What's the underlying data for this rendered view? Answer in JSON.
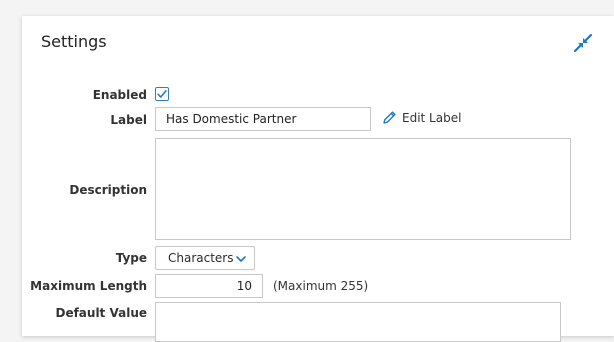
{
  "panel": {
    "title": "Settings",
    "collapse_icon": "collapse-arrows-icon",
    "accent_color": "#1f78c8"
  },
  "fields": {
    "enabled": {
      "label": "Enabled",
      "checked": true
    },
    "label": {
      "label": "Label",
      "value": "Has Domestic Partner",
      "edit_link": "Edit Label"
    },
    "description": {
      "label": "Description",
      "value": ""
    },
    "type": {
      "label": "Type",
      "value": "Characters"
    },
    "max_length": {
      "label": "Maximum Length",
      "value": "10",
      "hint": "(Maximum 255)"
    },
    "default_value": {
      "label": "Default Value",
      "value": ""
    }
  }
}
